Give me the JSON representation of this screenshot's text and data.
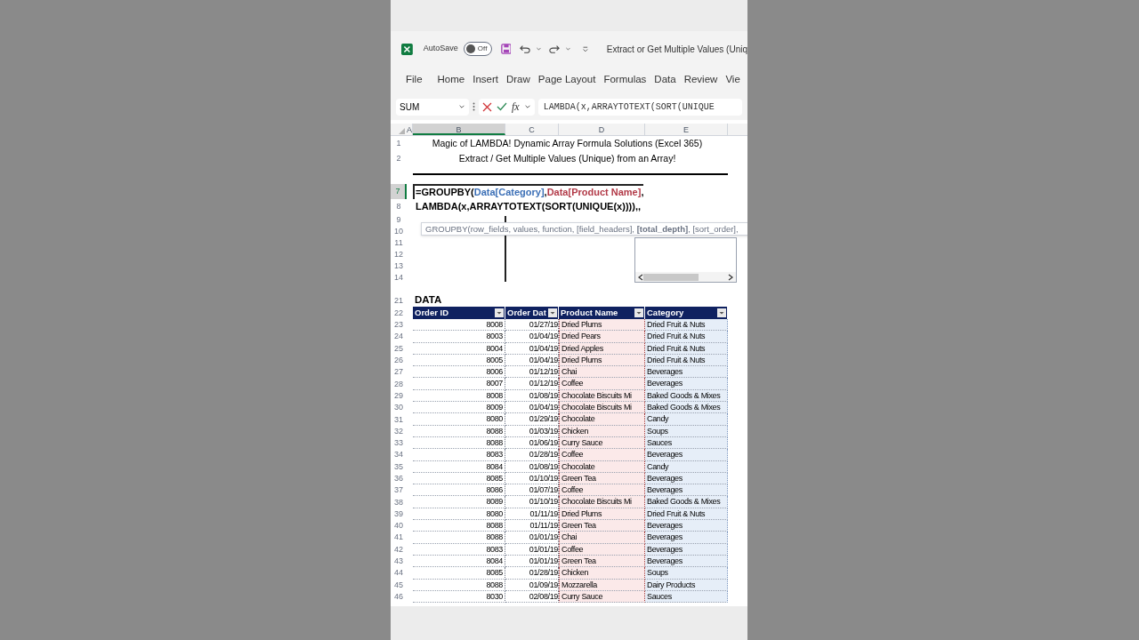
{
  "title_bar": {
    "autosave_label": "AutoSave",
    "autosave": {
      "on": false,
      "label": "Off"
    },
    "title": "Extract or Get Multiple Values (Uniq"
  },
  "ribbon_tabs": [
    "File",
    "Home",
    "Insert",
    "Draw",
    "Page Layout",
    "Formulas",
    "Data",
    "Review",
    "Vie"
  ],
  "formula_bar": {
    "name_box": "SUM",
    "fx": "fx",
    "formula": "LAMBDA(x,ARRAYTOTEXT(SORT(UNIQUE"
  },
  "columns": [
    {
      "label": "A",
      "selected": false
    },
    {
      "label": "B",
      "selected": true
    },
    {
      "label": "C",
      "selected": false
    },
    {
      "label": "D",
      "selected": false
    },
    {
      "label": "E",
      "selected": false
    }
  ],
  "title_rows": [
    {
      "number": "1",
      "text": "Magic of LAMBDA! Dynamic Array Formula Solutions (Excel 365)"
    },
    {
      "number": "2",
      "text": "Extract / Get Multiple Values (Unique) from an Array!"
    }
  ],
  "formula_rows": [
    {
      "number": "7",
      "selected": true,
      "segments": [
        {
          "kind": "plain",
          "text": "=GROUPBY("
        },
        {
          "kind": "category",
          "text": "Data[Category]"
        },
        {
          "kind": "plain",
          "text": ","
        },
        {
          "kind": "product",
          "text": "Data[Product Name]"
        },
        {
          "kind": "plain",
          "text": ","
        }
      ]
    },
    {
      "number": "8",
      "selected": false,
      "segments": [
        {
          "kind": "plain",
          "text": "LAMBDA(x,ARRAYTOTEXT(SORT(UNIQUE(x)))),,"
        }
      ]
    }
  ],
  "empty_rows": [
    "9",
    "10",
    "11",
    "12",
    "13",
    "14"
  ],
  "tooltip": "GROUPBY(row_fields, values, function, [field_headers], **[total_depth]**, [sort_order],",
  "data_title": {
    "number": "21",
    "text": "DATA"
  },
  "table": {
    "header_number": "22",
    "columns": [
      "Order ID",
      "Order Dat",
      "Product Name",
      "Category"
    ],
    "rows": [
      {
        "number": "23",
        "cells": [
          "8008",
          "01/27/19",
          "Dried Plums",
          "Dried Fruit & Nuts"
        ]
      },
      {
        "number": "24",
        "cells": [
          "8003",
          "01/04/19",
          "Dried Pears",
          "Dried Fruit & Nuts"
        ]
      },
      {
        "number": "25",
        "cells": [
          "8004",
          "01/04/19",
          "Dried Apples",
          "Dried Fruit & Nuts"
        ]
      },
      {
        "number": "26",
        "cells": [
          "8005",
          "01/04/19",
          "Dried Plums",
          "Dried Fruit & Nuts"
        ]
      },
      {
        "number": "27",
        "cells": [
          "8006",
          "01/12/19",
          "Chai",
          "Beverages"
        ]
      },
      {
        "number": "28",
        "cells": [
          "8007",
          "01/12/19",
          "Coffee",
          "Beverages"
        ]
      },
      {
        "number": "29",
        "cells": [
          "8008",
          "01/08/19",
          "Chocolate Biscuits Mi",
          "Baked Goods & Mixes"
        ]
      },
      {
        "number": "30",
        "cells": [
          "8009",
          "01/04/19",
          "Chocolate Biscuits Mi",
          "Baked Goods & Mixes"
        ]
      },
      {
        "number": "31",
        "cells": [
          "8080",
          "01/29/19",
          "Chocolate",
          "Candy"
        ]
      },
      {
        "number": "32",
        "cells": [
          "8088",
          "01/03/19",
          "Chicken",
          "Soups"
        ]
      },
      {
        "number": "33",
        "cells": [
          "8088",
          "01/06/19",
          "Curry Sauce",
          "Sauces"
        ]
      },
      {
        "number": "34",
        "cells": [
          "8083",
          "01/28/19",
          "Coffee",
          "Beverages"
        ]
      },
      {
        "number": "35",
        "cells": [
          "8084",
          "01/08/19",
          "Chocolate",
          "Candy"
        ]
      },
      {
        "number": "36",
        "cells": [
          "8085",
          "01/10/19",
          "Green Tea",
          "Beverages"
        ]
      },
      {
        "number": "37",
        "cells": [
          "8086",
          "01/07/19",
          "Coffee",
          "Beverages"
        ]
      },
      {
        "number": "38",
        "cells": [
          "8089",
          "01/10/19",
          "Chocolate Biscuits Mi",
          "Baked Goods & Mixes"
        ]
      },
      {
        "number": "39",
        "cells": [
          "8080",
          "01/11/19",
          "Dried Plums",
          "Dried Fruit & Nuts"
        ]
      },
      {
        "number": "40",
        "cells": [
          "8088",
          "01/11/19",
          "Green Tea",
          "Beverages"
        ]
      },
      {
        "number": "41",
        "cells": [
          "8088",
          "01/01/19",
          "Chai",
          "Beverages"
        ]
      },
      {
        "number": "42",
        "cells": [
          "8083",
          "01/01/19",
          "Coffee",
          "Beverages"
        ]
      },
      {
        "number": "43",
        "cells": [
          "8084",
          "01/01/19",
          "Green Tea",
          "Beverages"
        ]
      },
      {
        "number": "44",
        "cells": [
          "8085",
          "01/28/19",
          "Chicken",
          "Soups"
        ]
      },
      {
        "number": "45",
        "cells": [
          "8088",
          "01/09/19",
          "Mozzarella",
          "Dairy Products"
        ]
      },
      {
        "number": "46",
        "cells": [
          "8030",
          "02/08/19",
          "Curry Sauce",
          "Sauces"
        ]
      }
    ]
  }
}
